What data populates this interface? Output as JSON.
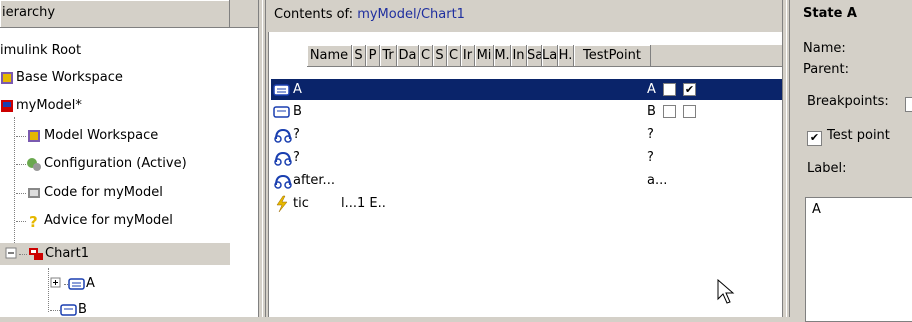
{
  "hierarchy": {
    "header": "ierarchy",
    "items": [
      {
        "label": "imulink Root"
      },
      {
        "label": "Base Workspace"
      },
      {
        "label": "myModel*"
      },
      {
        "label": "Model Workspace"
      },
      {
        "label": "Configuration (Active)"
      },
      {
        "label": "Code for myModel"
      },
      {
        "label": "Advice for myModel"
      },
      {
        "label": "Chart1"
      },
      {
        "label": "A"
      },
      {
        "label": "B"
      }
    ]
  },
  "contents": {
    "title_prefix": "Contents of: ",
    "title_path": "myModel/Chart1",
    "columns": [
      "Name",
      "S",
      "P",
      "Tr",
      "Da",
      "C",
      "S",
      "C",
      "Ir",
      "Mi",
      "M.",
      "In",
      "Sa",
      "La",
      "H.",
      "TestPoint"
    ],
    "rows": [
      {
        "name": "A",
        "lastcol": "A",
        "h": "unchecked",
        "tp": "checked",
        "selected": true
      },
      {
        "name": "B",
        "lastcol": "B",
        "h": "unchecked",
        "tp": "unchecked",
        "selected": false
      },
      {
        "name": "?",
        "lastcol": "?",
        "selected": false
      },
      {
        "name": "?",
        "lastcol": "?",
        "selected": false
      },
      {
        "name": "after...",
        "lastcol": "a...",
        "selected": false
      },
      {
        "name": "tic",
        "extra": "l...1  E..",
        "selected": false
      }
    ]
  },
  "properties": {
    "title": "State A",
    "name_label": "Name:",
    "parent_label": "Parent:",
    "breakpoints_label": "Breakpoints:",
    "testpoint_label": "Test point",
    "label_label": "Label:",
    "label_value": "A"
  }
}
